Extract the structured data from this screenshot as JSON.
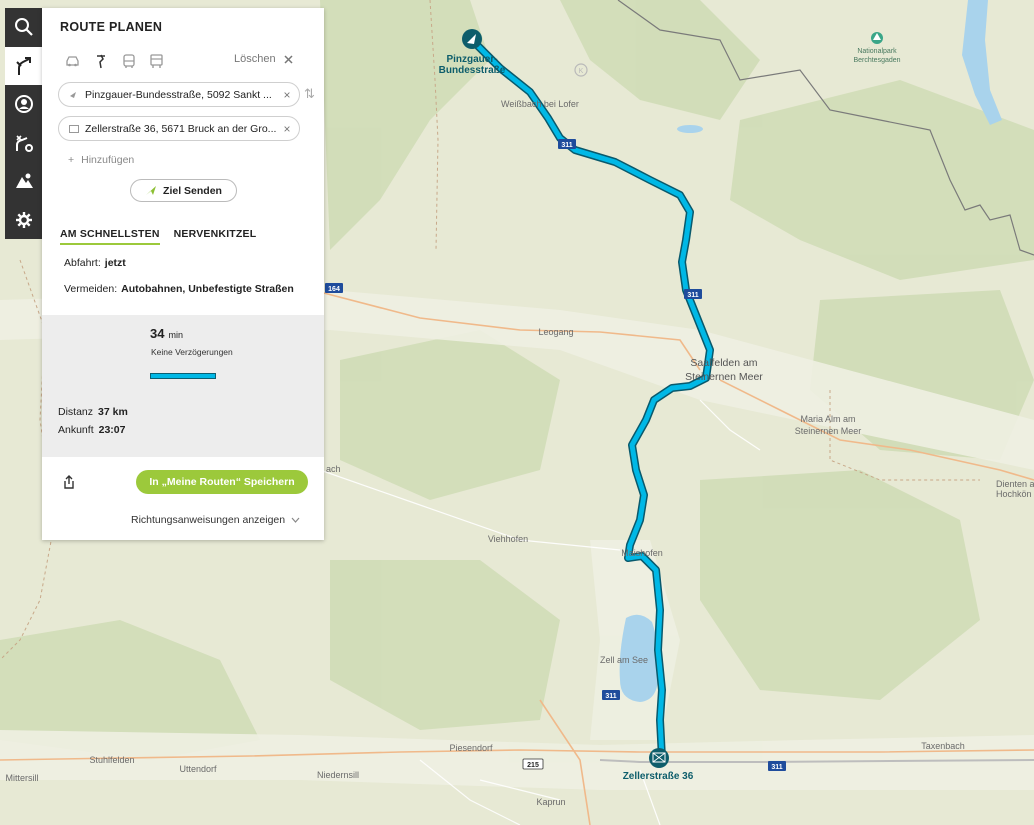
{
  "panel": {
    "title": "ROUTE PLANEN",
    "clear_label": "Löschen",
    "start_field": "Pinzgauer-Bundesstraße, 5092 Sankt ...",
    "destination_field": "Zellerstraße 36, 5671 Bruck an der Gro...",
    "add_label": "Hinzufügen",
    "send_label": "Ziel Senden",
    "tabs": [
      "AM SCHNELLSTEN",
      "NERVENKITZEL"
    ],
    "departure_label": "Abfahrt:",
    "departure_value": "jetzt",
    "avoid_label": "Vermeiden:",
    "avoid_value": "Autobahnen, Unbefestigte Straßen",
    "duration_value": "34",
    "duration_unit": "min",
    "delay_text": "Keine Verzögerungen",
    "distance_label": "Distanz",
    "distance_value": "37 km",
    "arrival_label": "Ankunft",
    "arrival_value": "23:07",
    "save_label": "In „Meine Routen“ Speichern",
    "directions_label": "Richtungsanweisungen anzeigen"
  },
  "rail": {
    "items": [
      "search-icon",
      "route-icon",
      "profile-icon",
      "routes-list-icon",
      "poi-icon",
      "settings-icon"
    ],
    "active": "route-icon"
  },
  "map": {
    "route_color": "#00b8e6",
    "start_label": [
      "Pinzgauer-",
      "Bundesstraße"
    ],
    "end_label": "Zellerstraße 36",
    "park_label": [
      "Nationalpark",
      "Berchtesgaden"
    ],
    "places": {
      "weissbach": "Weißbach bei Lofer",
      "leogang": "Leogang",
      "saalfelden": [
        "Saalfelden am",
        "Steinernen Meer"
      ],
      "maria_alm": [
        "Maria Alm am",
        "Steinernen Meer"
      ],
      "dienten": [
        "Dienten a",
        "Hochkön"
      ],
      "viehhofen": "Viehhofen",
      "maishofen": "Maishofen",
      "zell": "Zell am See",
      "piesendorf": "Piesendorf",
      "stuhlfelden": "Stuhlfelden",
      "mittersill": "Mittersill",
      "uttendorf": "Uttendorf",
      "niedernsill": "Niedernsill",
      "kaprun": "Kaprun",
      "taxenbach": "Taxenbach",
      "bach": "ach"
    },
    "roads": [
      "311",
      "164",
      "215"
    ]
  }
}
